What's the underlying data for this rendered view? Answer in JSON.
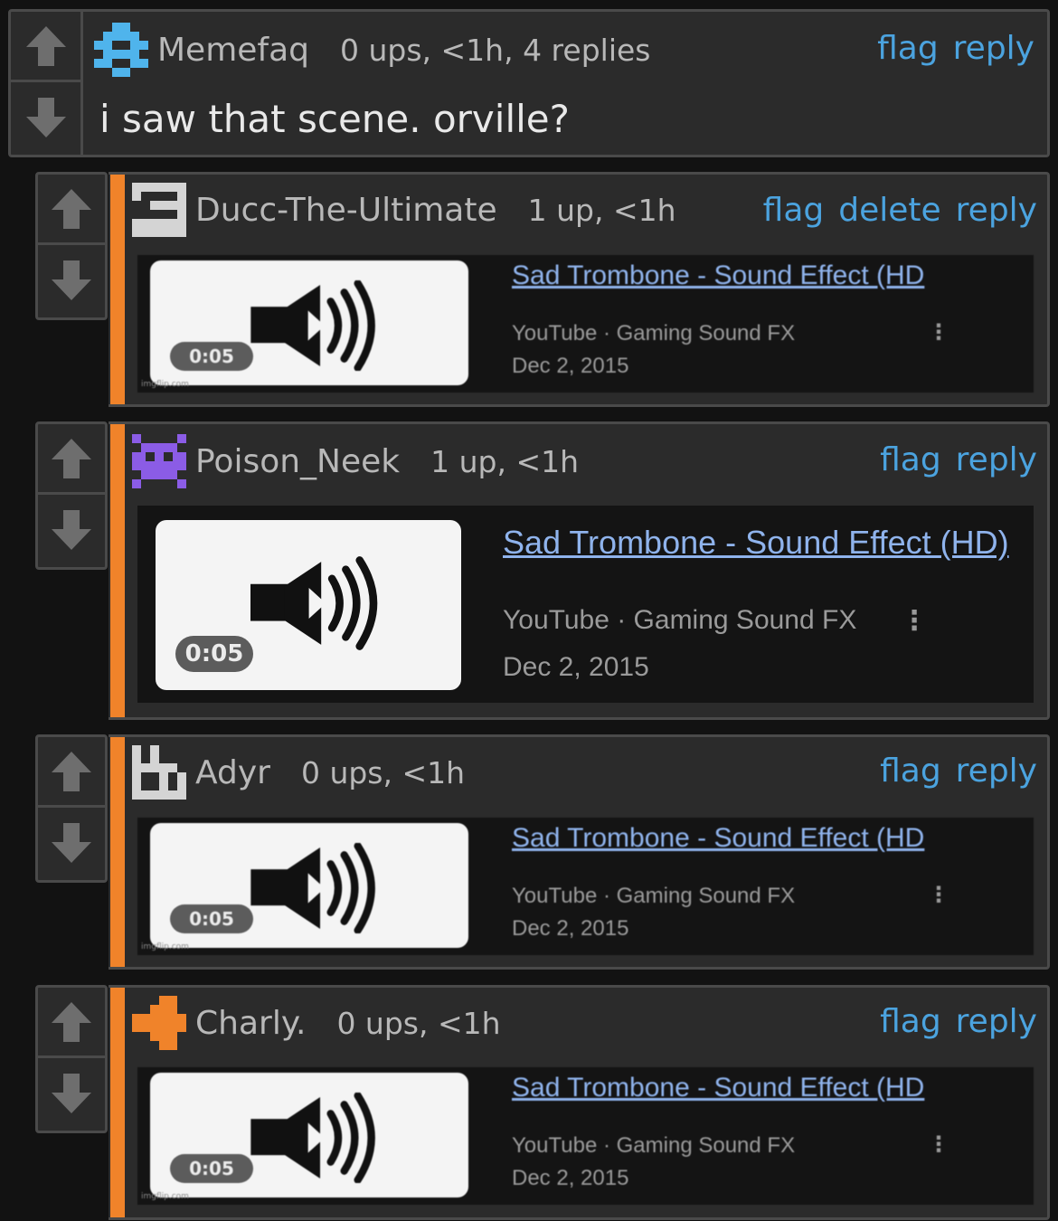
{
  "comments": [
    {
      "user": "Memefaq",
      "meta": "0 ups, <1h, 4 replies",
      "text": "i saw that scene. orville?",
      "actions": [
        "flag",
        "reply"
      ],
      "avatar_color": "#4fb4ec"
    },
    {
      "user": "Ducc-The-Ultimate",
      "meta": "1 up, <1h",
      "actions": [
        "flag",
        "delete",
        "reply"
      ],
      "avatar_color": "#d4d4d4",
      "video": {
        "title": "Sad Trombone - Sound Effect (HD",
        "channel": "YouTube · Gaming Sound FX",
        "date": "Dec 2, 2015",
        "duration": "0:05",
        "watermark": "imgflip.com"
      }
    },
    {
      "user": "Poison_Neek",
      "meta": "1 up, <1h",
      "actions": [
        "flag",
        "reply"
      ],
      "avatar_color": "#8b5ce6",
      "video": {
        "title": "Sad Trombone - Sound Effect (HD)",
        "channel": "YouTube · Gaming Sound FX",
        "date": "Dec 2, 2015",
        "duration": "0:05"
      }
    },
    {
      "user": "Adyr",
      "meta": "0 ups, <1h",
      "actions": [
        "flag",
        "reply"
      ],
      "avatar_color": "#d4d4d4",
      "video": {
        "title": "Sad Trombone - Sound Effect (HD",
        "channel": "YouTube · Gaming Sound FX",
        "date": "Dec 2, 2015",
        "duration": "0:05",
        "watermark": "imgflip.com"
      }
    },
    {
      "user": "Charly.",
      "meta": "0 ups, <1h",
      "actions": [
        "flag",
        "reply"
      ],
      "avatar_color": "#f0832a",
      "video": {
        "title": "Sad Trombone - Sound Effect (HD",
        "channel": "YouTube · Gaming Sound FX",
        "date": "Dec 2, 2015",
        "duration": "0:05",
        "watermark": "imgflip.com"
      }
    }
  ],
  "colors": {
    "accent_link": "#4ba3df",
    "reply_stripe": "#f0832a",
    "background": "#121212",
    "panel": "#2b2b2b"
  }
}
